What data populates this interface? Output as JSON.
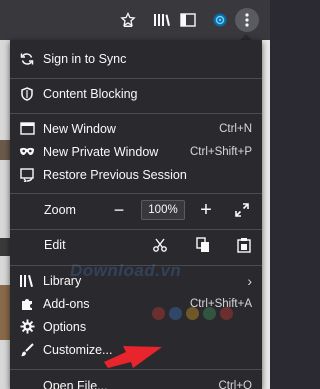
{
  "toolbar": {
    "icons": [
      "star-badge-icon",
      "library-icon",
      "sidebar-icon",
      "extension-icon",
      "menu-icon"
    ]
  },
  "menu": {
    "sync": {
      "label": "Sign in to Sync",
      "icon": "sync-icon"
    },
    "content_blocking": {
      "label": "Content Blocking",
      "icon": "shield-icon"
    },
    "new_window": {
      "label": "New Window",
      "shortcut": "Ctrl+N",
      "icon": "new-window-icon"
    },
    "new_private": {
      "label": "New Private Window",
      "shortcut": "Ctrl+Shift+P",
      "icon": "private-mask-icon"
    },
    "restore": {
      "label": "Restore Previous Session",
      "icon": "restore-session-icon"
    },
    "zoom": {
      "label": "Zoom",
      "value": "100%",
      "minus": "−",
      "plus": "+"
    },
    "edit": {
      "label": "Edit"
    },
    "library": {
      "label": "Library",
      "icon": "library-icon"
    },
    "addons": {
      "label": "Add-ons",
      "shortcut": "Ctrl+Shift+A",
      "icon": "puzzle-icon"
    },
    "options": {
      "label": "Options",
      "icon": "gear-icon"
    },
    "customize": {
      "label": "Customize...",
      "icon": "paintbrush-icon"
    },
    "open_file": {
      "label": "Open File...",
      "shortcut": "Ctrl+O"
    }
  },
  "watermark": "Download.vn",
  "colors": {
    "panel_bg": "#2a2a2e",
    "toolbar_bg": "#38383d",
    "text": "#f9f9fa",
    "annotation_arrow": "#e8242c",
    "dots": [
      "#e53935",
      "#3f7fd8",
      "#f2b01e",
      "#3fa75f",
      "#e53935"
    ]
  }
}
